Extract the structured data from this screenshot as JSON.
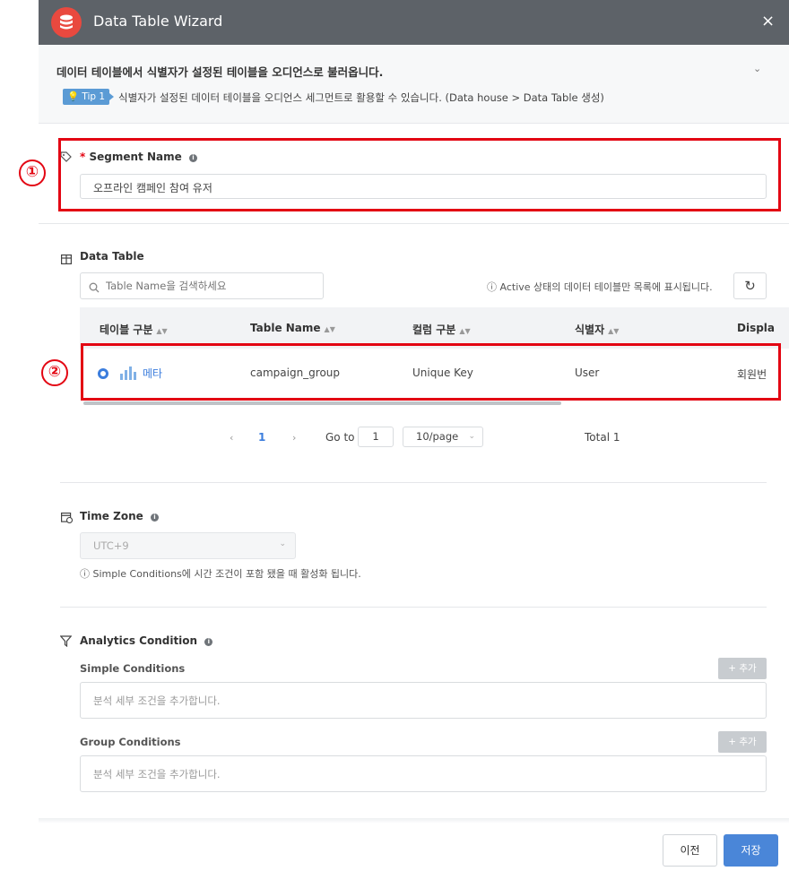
{
  "header": {
    "title": "Data Table Wizard",
    "close_glyph": "×"
  },
  "intro": {
    "title": "데이터 테이블에서 식별자가 설정된 테이블을 오디언스로 불러옵니다.",
    "tip_badge": "Tip 1",
    "tip_text": "식별자가 설정된 데이터 테이블을 오디언스 세그먼트로 활용할 수 있습니다. (Data house > Data Table 생성)"
  },
  "segment": {
    "required_mark": "*",
    "label": "Segment Name",
    "value": "오프라인 캠페인 참여 유저"
  },
  "data_table": {
    "label": "Data Table",
    "search_placeholder": "Table Name을 검색하세요",
    "active_note": "Active 상태의 데이터 테이블만 목록에 표시됩니다.",
    "columns": [
      "테이블 구분",
      "Table Name",
      "컬럼 구분",
      "식별자",
      "Displa"
    ],
    "rows": [
      {
        "type": "메타",
        "table_name": "campaign_group",
        "column_type": "Unique Key",
        "identifier": "User",
        "display": "회원번"
      }
    ],
    "pagination": {
      "current": "1",
      "goto_label": "Go to",
      "goto_value": "1",
      "page_size": "10/page",
      "total": "Total 1"
    }
  },
  "time_zone": {
    "label": "Time Zone",
    "value": "UTC+9",
    "note": "Simple Conditions에 시간 조건이 포함 됐을 때 활성화 됩니다."
  },
  "analytics": {
    "label": "Analytics Condition",
    "simple_label": "Simple Conditions",
    "group_label": "Group Conditions",
    "add_label": "+ 추가",
    "placeholder": "분석 세부 조건을 추가합니다."
  },
  "footer": {
    "prev": "이전",
    "save": "저장"
  },
  "annotations": {
    "marker1": "①",
    "marker2": "②"
  },
  "colors": {
    "header_bg": "#5d6268",
    "accent": "#4a86d8",
    "highlight": "#e30613",
    "logo": "#e9493f"
  }
}
